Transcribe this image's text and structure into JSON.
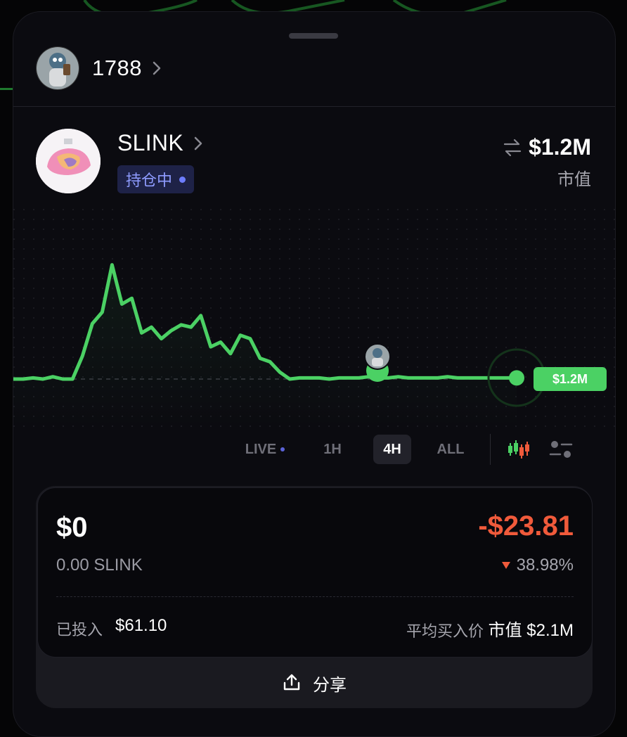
{
  "user": {
    "name": "1788"
  },
  "token": {
    "symbol": "SLINK",
    "badge": "持仓中",
    "market_cap": "$1.2M",
    "market_cap_label": "市值"
  },
  "chart": {
    "price_label": "$1.2M",
    "line_color": "#4bd164",
    "chart_data": {
      "type": "line",
      "series": [
        {
          "values": [
            0,
            0,
            0.01,
            0,
            0.02,
            0,
            0,
            0.2,
            0.48,
            0.58,
            0.99,
            0.65,
            0.7,
            0.4,
            0.45,
            0.35,
            0.42,
            0.47,
            0.45,
            0.55,
            0.28,
            0.32,
            0.22,
            0.38,
            0.35,
            0.18,
            0.15,
            0.06,
            0,
            0.01,
            0.01,
            0.01,
            0,
            0.01,
            0.01,
            0.01,
            0.02,
            0.01,
            0.01,
            0.02,
            0.01,
            0.01,
            0.01,
            0.01,
            0.02,
            0.01,
            0.01,
            0.01,
            0.01,
            0.01,
            0.01,
            0.01
          ]
        }
      ]
    }
  },
  "ranges": {
    "live": "LIVE",
    "h1": "1H",
    "h4": "4H",
    "all": "ALL",
    "selected": "4H"
  },
  "position": {
    "value_usd": "$0",
    "token_amount": "0.00 SLINK",
    "pnl_usd": "-$23.81",
    "pnl_pct": "38.98%",
    "invested_label": "已投入",
    "invested_value": "$61.10",
    "avg_price_label": "平均买入价",
    "avg_price_value": "市值 $2.1M",
    "pnl_color": "#f05a3b"
  },
  "share": {
    "label": "分享"
  }
}
